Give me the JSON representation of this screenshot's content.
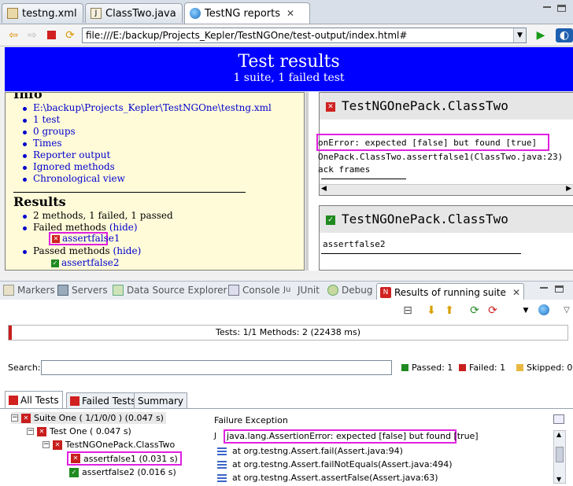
{
  "editor_tabs": [
    {
      "label": "testng.xml",
      "active": false
    },
    {
      "label": "ClassTwo.java",
      "active": false
    },
    {
      "label": "TestNG reports",
      "active": true
    }
  ],
  "browser": {
    "url": "file:///E:/backup/Projects_Kepler/TestNGOne/test-output/index.html#"
  },
  "report": {
    "title": "Test results",
    "subtitle": "1 suite, 1 failed test",
    "info_heading": "Info",
    "info_items": [
      "E:\\backup\\Projects_Kepler\\TestNGOne\\testng.xml",
      "1 test",
      "0 groups",
      "Times",
      "Reporter output",
      "Ignored methods",
      "Chronological view"
    ],
    "results_heading": "Results",
    "results_summary": "2 methods, 1 failed, 1 passed",
    "failed_methods_label": "Failed methods",
    "passed_methods_label": "Passed methods",
    "hide_label": "(hide)",
    "failed_method": "assertfalse1",
    "passed_method": "assertfalse2",
    "failed_card": {
      "class_name": "TestNGOnePack.ClassTwo",
      "error_line": "onError: expected [false] but found [true]",
      "trace_line": "OnePack.ClassTwo.assertfalse1(ClassTwo.java:23)",
      "frames_line": "ack frames"
    },
    "passed_card": {
      "class_name": "TestNGOnePack.ClassTwo",
      "method": "assertfalse2"
    }
  },
  "view_tabs": [
    {
      "label": "Markers",
      "icon": "markers-icon"
    },
    {
      "label": "Servers",
      "icon": "servers-icon"
    },
    {
      "label": "Data Source Explorer",
      "icon": "datasource-icon"
    },
    {
      "label": "Console",
      "icon": "console-icon"
    },
    {
      "label": "JUnit",
      "icon": "junit-icon"
    },
    {
      "label": "Debug",
      "icon": "debug-icon"
    },
    {
      "label": "Results of running suite",
      "icon": "testng-icon",
      "active": true
    }
  ],
  "results_view": {
    "progress_text": "Tests: 1/1  Methods: 2 (22438 ms)",
    "progress_fraction": 0.005,
    "search_label": "Search:",
    "search_value": "",
    "passed_label": "Passed: 1",
    "failed_label": "Failed: 1",
    "skipped_label": "Skipped: 0",
    "subtabs": [
      "All Tests",
      "Failed Tests",
      "Summary"
    ],
    "tree": [
      {
        "label": "Suite One ( 1/1/0/0 ) (0.047 s)",
        "level": 0,
        "status": "fail"
      },
      {
        "label": "Test One ( 0.047 s)",
        "level": 1,
        "status": "fail"
      },
      {
        "label": "TestNGOnePack.ClassTwo",
        "level": 2,
        "status": "fail"
      },
      {
        "label": "assertfalse1  (0.031 s)",
        "level": 3,
        "status": "fail"
      },
      {
        "label": "assertfalse2  (0.016 s)",
        "level": 3,
        "status": "pass"
      }
    ],
    "failure_title": "Failure Exception",
    "failure_lines": [
      "java.lang.AssertionError: expected [false] but found [true]",
      "at org.testng.Assert.fail(Assert.java:94)",
      "at org.testng.Assert.failNotEquals(Assert.java:494)",
      "at org.testng.Assert.assertFalse(Assert.java:63)"
    ]
  },
  "colors": {
    "report_header": "#0000ff",
    "info_panel": "#fffbd9",
    "highlight": "#e020e0",
    "fail": "#c81e1e",
    "pass": "#208a20"
  }
}
